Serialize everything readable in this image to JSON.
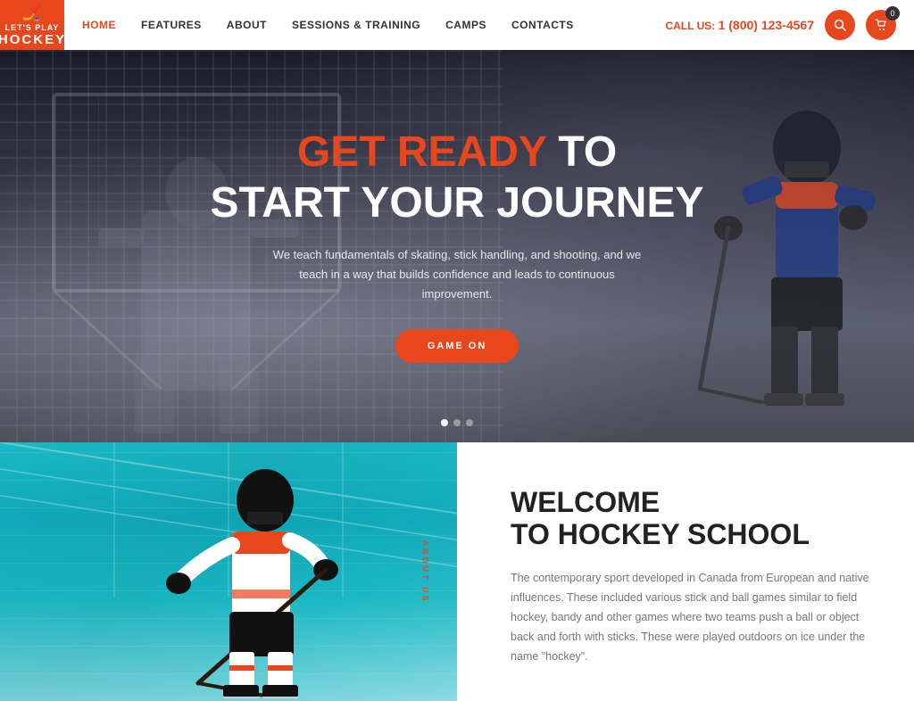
{
  "logo": {
    "lets": "LET'S PLAY",
    "hockey": "HOCKEY"
  },
  "nav": {
    "links": [
      {
        "label": "HOME",
        "active": true
      },
      {
        "label": "FEATURES",
        "active": false
      },
      {
        "label": "ABOUT",
        "active": false
      },
      {
        "label": "SESSIONS & TRAINING",
        "active": false
      },
      {
        "label": "CAMPS",
        "active": false
      },
      {
        "label": "CONTACTS",
        "active": false
      }
    ],
    "call_label": "CALL US:",
    "phone": "1 (800) 123-4567",
    "cart_count": "0"
  },
  "hero": {
    "title_orange": "GET READY",
    "title_white": "TO",
    "title_line2": "START YOUR JOURNEY",
    "subtitle": "We teach fundamentals of skating, stick handling, and shooting, and we teach in a way that builds confidence and leads to continuous improvement.",
    "button_label": "GAME ON",
    "dots": [
      true,
      false,
      false
    ]
  },
  "about": {
    "vertical_label": "ABOUT US",
    "title_line1": "WELCOME",
    "title_line2": "TO HOCKEY SCHOOL",
    "text": "The contemporary sport developed in Canada from European and native influences. These included various stick and ball games similar to field hockey, bandy and other games where two teams push a ball or object back and forth with sticks. These were played outdoors on ice under the name \"hockey\"."
  }
}
